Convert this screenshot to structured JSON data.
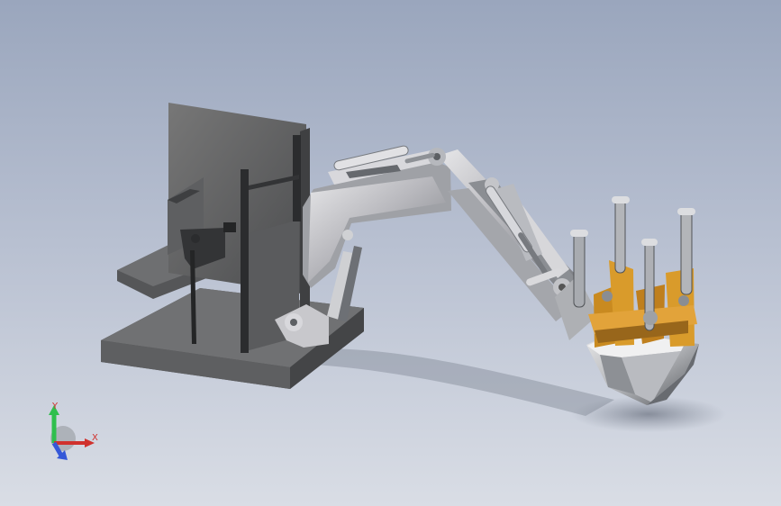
{
  "viewport": {
    "background": [
      "#9aa6bd",
      "#d9dde5"
    ],
    "model_colors": {
      "steel": "#b8b8bd",
      "dark_steel": "#6c6f73",
      "frame": "#5f6062",
      "accent": "#d99b2b",
      "shadow": "#6b7382"
    }
  },
  "triad": {
    "x_label": "X",
    "y_label": "Y",
    "x_color": "#d0312d",
    "y_color": "#2fbf4d",
    "z_color": "#3558d8"
  },
  "icons": {
    "triad": "coordinate-axes-icon"
  }
}
